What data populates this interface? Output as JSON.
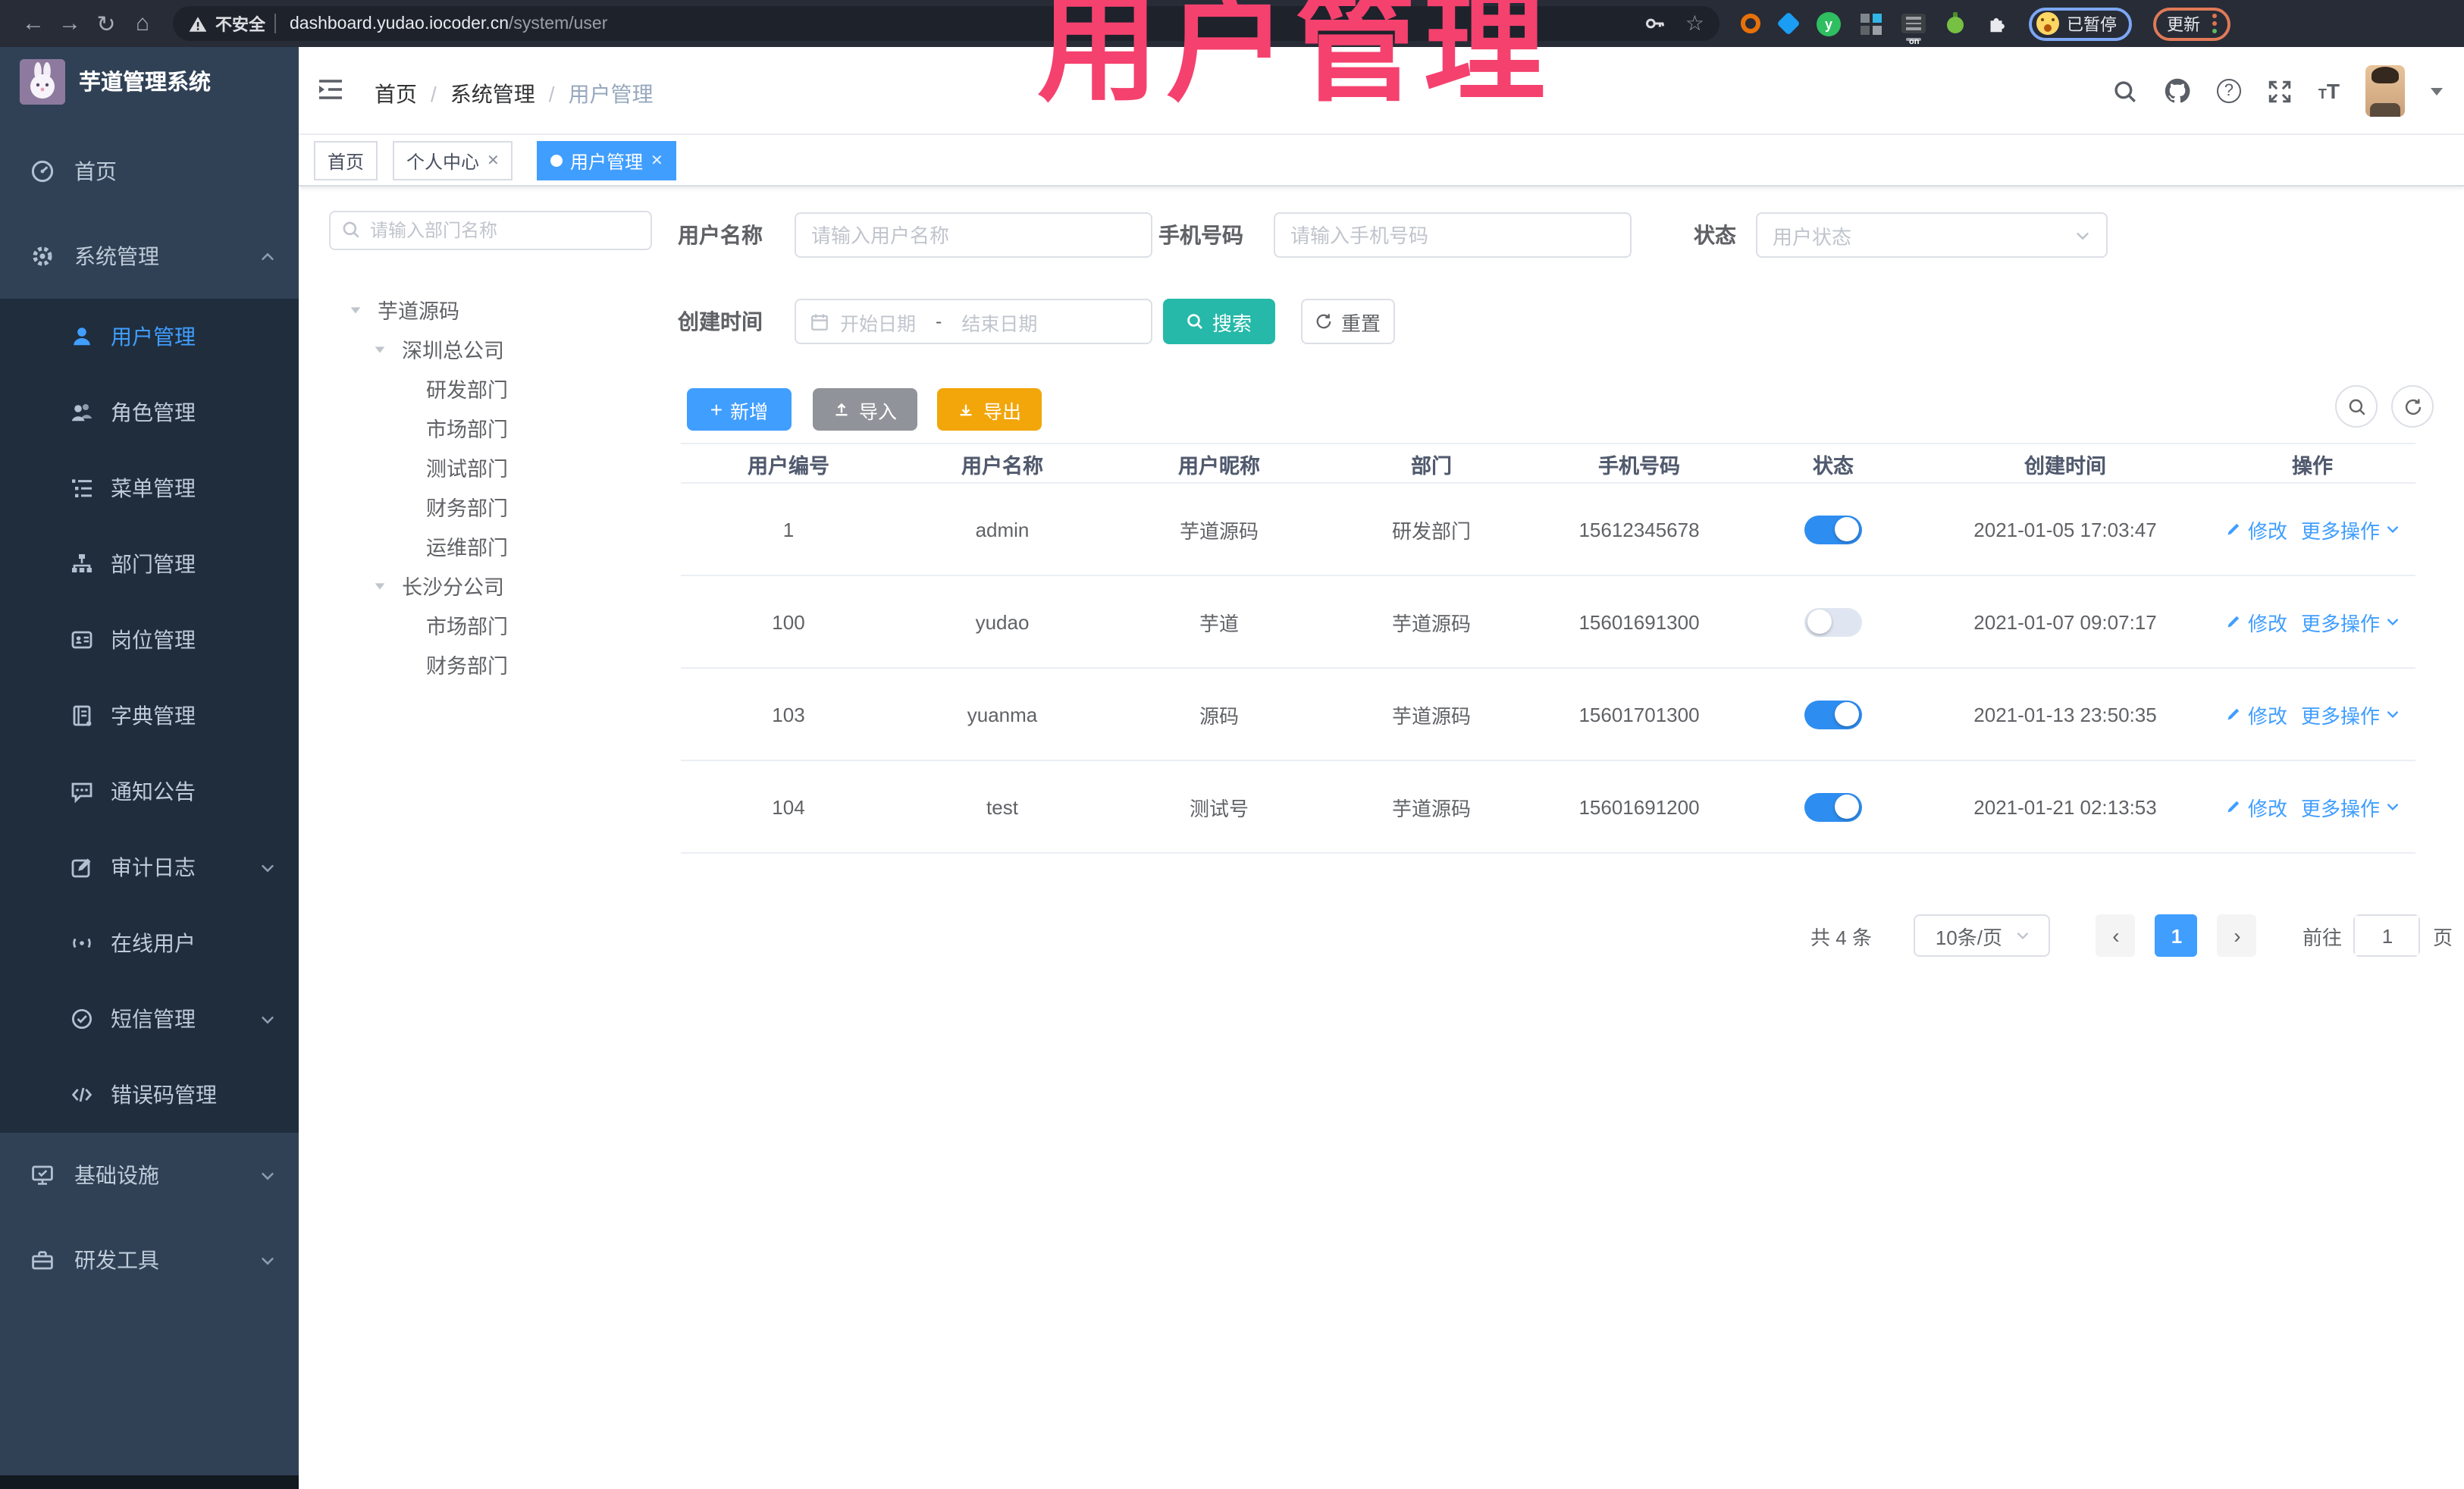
{
  "browser": {
    "security_label": "不安全",
    "url_host": "dashboard.yudao.iocoder.cn",
    "url_path": "/system/user",
    "paused_label": "已暂停",
    "update_label": "更新"
  },
  "watermark": "用户管理",
  "colors": {
    "accent": "#409eff",
    "search_button": "#26b9a9",
    "import_button": "#909399",
    "export_button": "#f2a60a",
    "toggle_on": "#2e8df0",
    "watermark": "#f5416e",
    "sidebar_bg": "#304156",
    "submenu_bg": "#1f2d3d"
  },
  "sidebar": {
    "app_title": "芋道管理系统",
    "items": [
      {
        "label": "首页"
      },
      {
        "label": "系统管理"
      },
      {
        "label": "用户管理"
      },
      {
        "label": "角色管理"
      },
      {
        "label": "菜单管理"
      },
      {
        "label": "部门管理"
      },
      {
        "label": "岗位管理"
      },
      {
        "label": "字典管理"
      },
      {
        "label": "通知公告"
      },
      {
        "label": "审计日志"
      },
      {
        "label": "在线用户"
      },
      {
        "label": "短信管理"
      },
      {
        "label": "错误码管理"
      },
      {
        "label": "基础设施"
      },
      {
        "label": "研发工具"
      }
    ]
  },
  "header": {
    "breadcrumb": [
      "首页",
      "系统管理",
      "用户管理"
    ]
  },
  "tabs": [
    {
      "label": "首页"
    },
    {
      "label": "个人中心"
    },
    {
      "label": "用户管理"
    }
  ],
  "tree": {
    "search_placeholder": "请输入部门名称",
    "nodes": [
      {
        "label": "芋道源码"
      },
      {
        "label": "深圳总公司"
      },
      {
        "label": "研发部门"
      },
      {
        "label": "市场部门"
      },
      {
        "label": "测试部门"
      },
      {
        "label": "财务部门"
      },
      {
        "label": "运维部门"
      },
      {
        "label": "长沙分公司"
      },
      {
        "label": "市场部门"
      },
      {
        "label": "财务部门"
      }
    ]
  },
  "filters": {
    "username_label": "用户名称",
    "username_placeholder": "请输入用户名称",
    "mobile_label": "手机号码",
    "mobile_placeholder": "请输入手机号码",
    "status_label": "状态",
    "status_placeholder": "用户状态",
    "created_label": "创建时间",
    "date_start_placeholder": "开始日期",
    "date_separator": "-",
    "date_end_placeholder": "结束日期",
    "search_label": "搜索",
    "reset_label": "重置"
  },
  "toolbar": {
    "add_label": "新增",
    "import_label": "导入",
    "export_label": "导出"
  },
  "table": {
    "columns": [
      "用户编号",
      "用户名称",
      "用户昵称",
      "部门",
      "手机号码",
      "状态",
      "创建时间",
      "操作"
    ],
    "action_edit": "修改",
    "action_more": "更多操作",
    "rows": [
      {
        "id": "1",
        "username": "admin",
        "nickname": "芋道源码",
        "dept": "研发部门",
        "mobile": "15612345678",
        "status": true,
        "created": "2021-01-05 17:03:47"
      },
      {
        "id": "100",
        "username": "yudao",
        "nickname": "芋道",
        "dept": "芋道源码",
        "mobile": "15601691300",
        "status": false,
        "created": "2021-01-07 09:07:17"
      },
      {
        "id": "103",
        "username": "yuanma",
        "nickname": "源码",
        "dept": "芋道源码",
        "mobile": "15601701300",
        "status": true,
        "created": "2021-01-13 23:50:35"
      },
      {
        "id": "104",
        "username": "test",
        "nickname": "测试号",
        "dept": "芋道源码",
        "mobile": "15601691200",
        "status": true,
        "created": "2021-01-21 02:13:53"
      }
    ]
  },
  "pagination": {
    "total_label": "共 4 条",
    "page_size_label": "10条/页",
    "current_page": "1",
    "goto_label": "前往",
    "goto_value": "1",
    "page_unit_label": "页"
  }
}
